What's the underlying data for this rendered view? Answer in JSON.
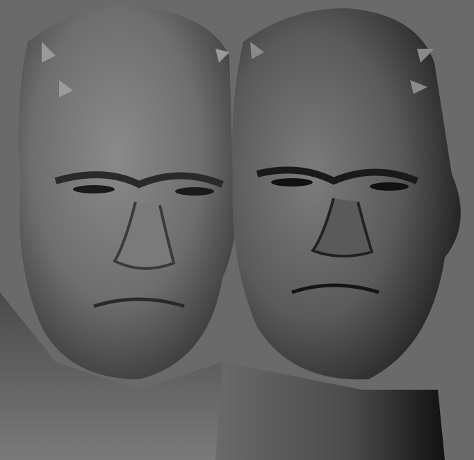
{
  "scene": {
    "background_color": "#6a6a6a",
    "models": [
      {
        "name": "left-head-render",
        "shading": "smooth"
      },
      {
        "name": "right-head-render",
        "shading": "displaced"
      }
    ]
  }
}
